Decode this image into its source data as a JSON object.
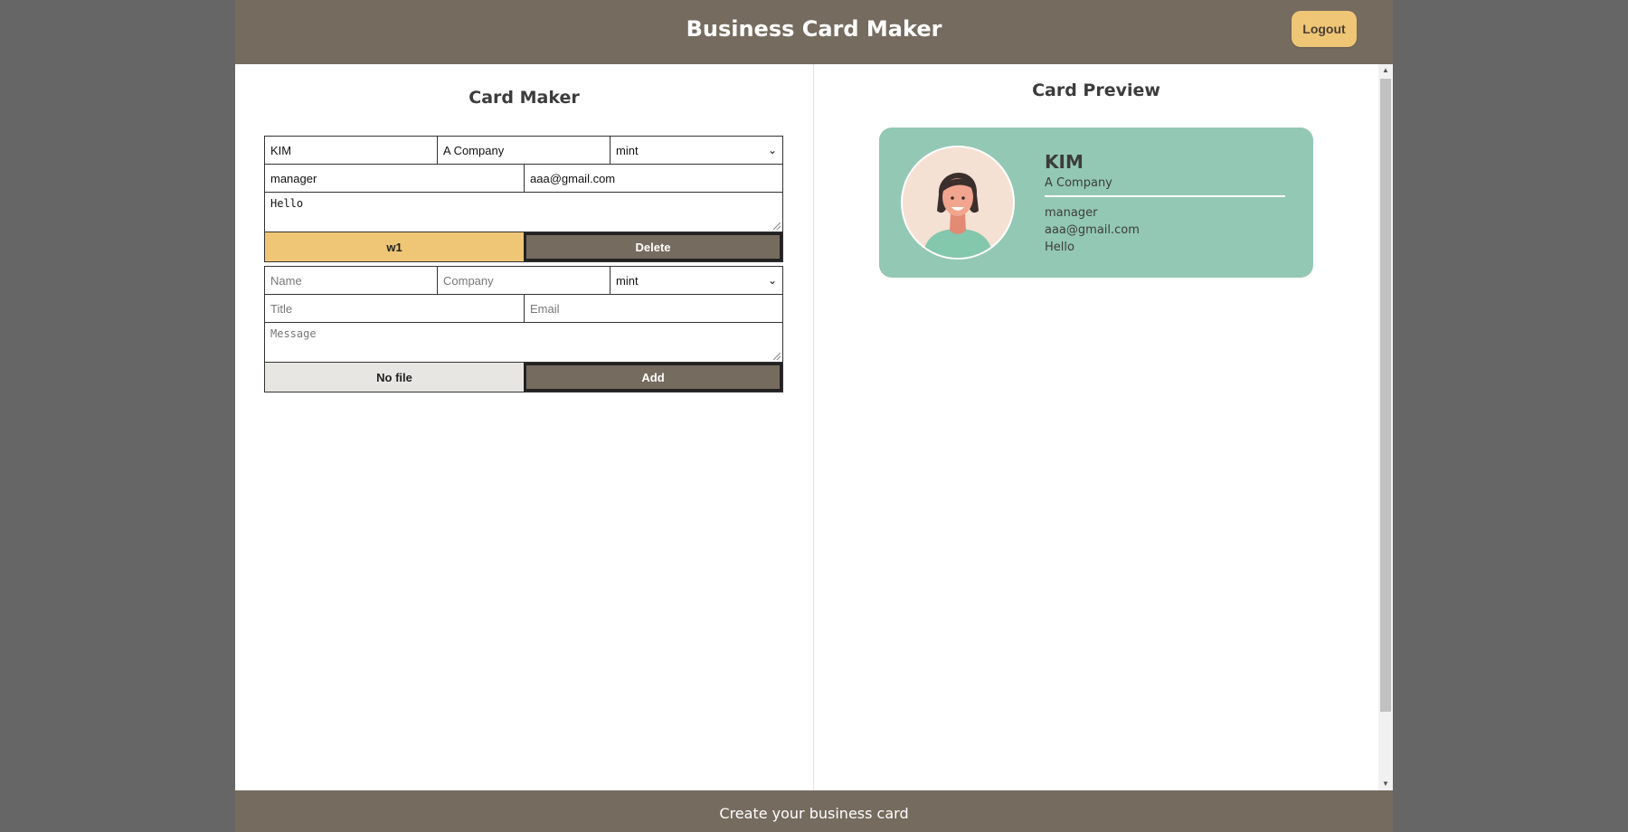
{
  "header": {
    "title": "Business Card Maker",
    "logout_label": "Logout"
  },
  "maker": {
    "title": "Card Maker",
    "card_form": {
      "name": "KIM",
      "company": "A Company",
      "theme": "mint",
      "title": "manager",
      "email": "aaa@gmail.com",
      "message": "Hello",
      "file_label": "w1",
      "delete_label": "Delete"
    },
    "add_form": {
      "name_placeholder": "Name",
      "company_placeholder": "Company",
      "theme": "mint",
      "title_placeholder": "Title",
      "email_placeholder": "Email",
      "message_placeholder": "Message",
      "file_label": "No file",
      "add_label": "Add"
    }
  },
  "preview": {
    "title": "Card Preview",
    "card": {
      "name": "KIM",
      "company": "A Company",
      "title": "manager",
      "email": "aaa@gmail.com",
      "message": "Hello",
      "background_color": "#93c8b4",
      "avatar_icon": "woman-avatar-icon"
    }
  },
  "footer": {
    "text": "Create your business card"
  },
  "colors": {
    "brand_brown": "#766b5f",
    "accent_yellow": "#efc676",
    "mint": "#93c8b4"
  }
}
